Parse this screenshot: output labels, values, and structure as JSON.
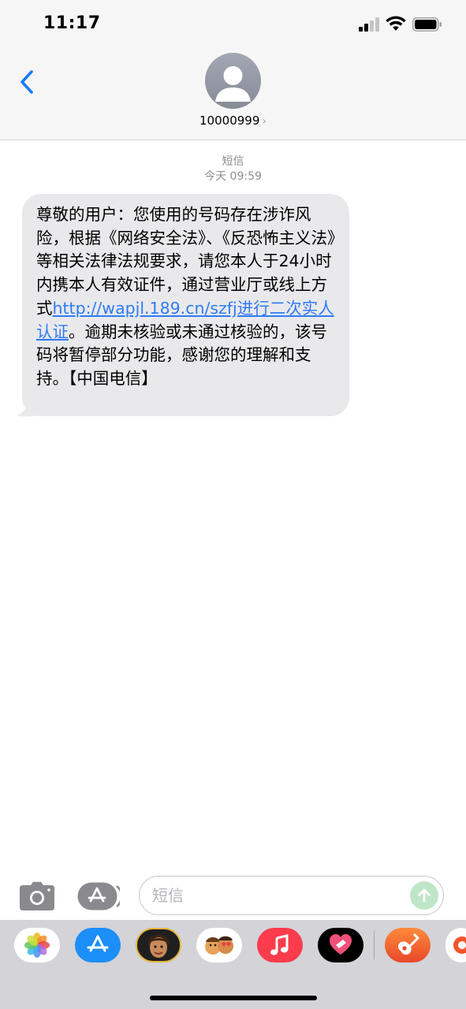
{
  "status_bar": {
    "time": "11:17"
  },
  "header": {
    "contact": "10000999",
    "chevron": "›"
  },
  "thread": {
    "service": "短信",
    "timestamp": "今天 09:59"
  },
  "message": {
    "text_before": "尊敬的用户：您使用的号码存在涉诈风险，根据《网络安全法》、《反恐怖主义法》等相关法律法规要求，请您本人于24小时内携本人有效证件，通过营业厅或线上方式",
    "link": "http://wapjl.189.cn/szfj进行二次实人认证",
    "text_after": "。逾期未核验或未通过核验的，该号码将暂停部分功能，感谢您的理解和支持。【中国电信】"
  },
  "input": {
    "placeholder": "短信"
  },
  "icons": {
    "back": "chevron-left-icon",
    "avatar": "person-icon",
    "camera": "camera-icon",
    "apps": "app-store-icon",
    "send": "arrow-up-icon"
  },
  "app_drawer": [
    "photos",
    "app-store",
    "memoji",
    "animoji-stickers",
    "music",
    "digital-touch",
    "garageband",
    "more-app"
  ],
  "colors": {
    "link": "#2f7bf5",
    "bubble": "#e9e9eb",
    "send_disabled": "#bfe6c6",
    "accent": "#1a7cf5"
  }
}
